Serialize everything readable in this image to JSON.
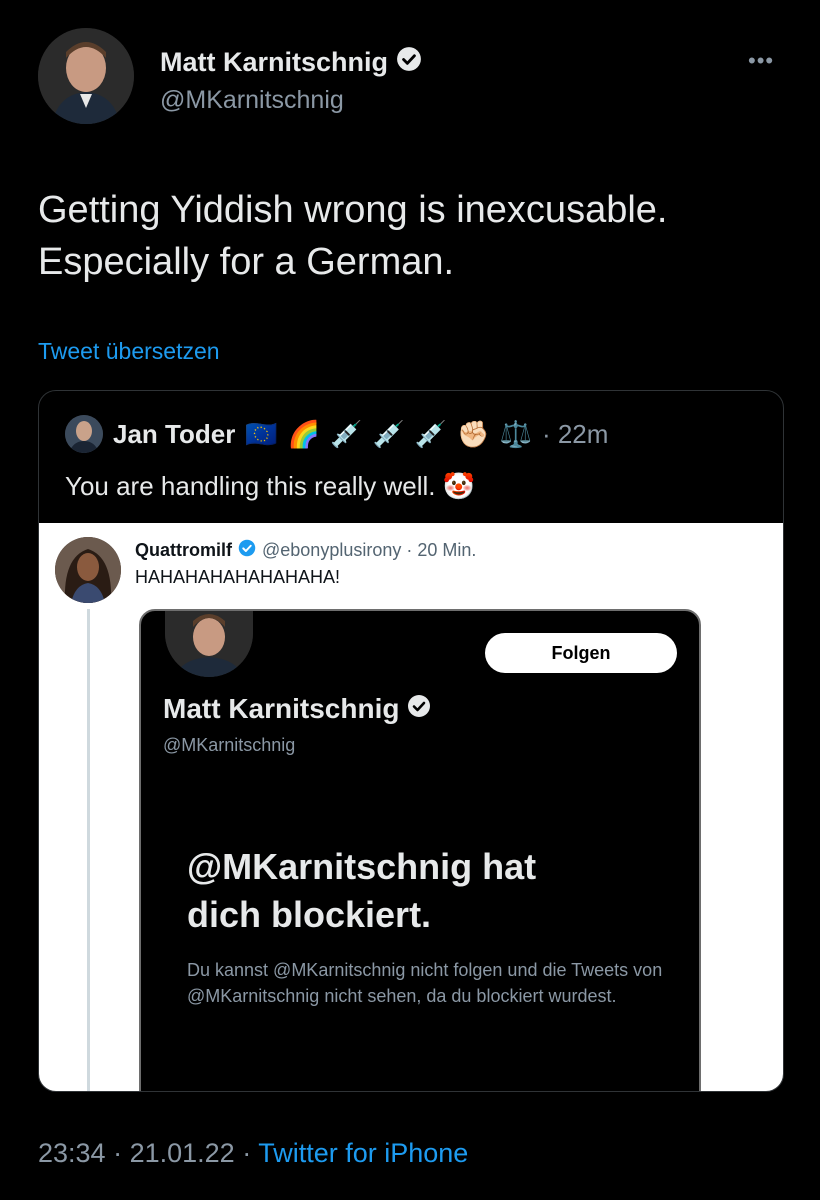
{
  "author": {
    "name": "Matt Karnitschnig",
    "handle": "@MKarnitschnig"
  },
  "more_label": "•••",
  "tweet": {
    "text_line1": "Getting Yiddish wrong is inexcusable.",
    "text_line2": "Especially for a German.",
    "translate_label": "Tweet übersetzen"
  },
  "quote": {
    "name": "Jan Toder",
    "emojis": [
      "🇪🇺",
      "🌈",
      "💉",
      "💉",
      "💉",
      "✊🏻",
      "⚖️"
    ],
    "time": "· 22m",
    "text": "You are handling this really well.",
    "text_emoji": "🤡"
  },
  "embedded": {
    "name": "Quattromilf",
    "meta": "@ebonyplusirony · 20 Min.",
    "text": "HAHAHAHAHAHAHAHA!",
    "profile": {
      "follow_label": "Folgen",
      "name": "Matt Karnitschnig",
      "handle": "@MKarnitschnig",
      "blocked_title_line1": "@MKarnitschnig hat",
      "blocked_title_line2": "dich blockiert.",
      "blocked_desc": "Du kannst @MKarnitschnig nicht folgen und die Tweets von @MKarnitschnig nicht sehen, da du blockiert wurdest."
    }
  },
  "footer": {
    "time": "23:34",
    "date": "21.01.22",
    "source": "Twitter for iPhone"
  },
  "colors": {
    "background": "#000000",
    "link": "#1d9bf0",
    "secondary": "#8b98a5"
  }
}
